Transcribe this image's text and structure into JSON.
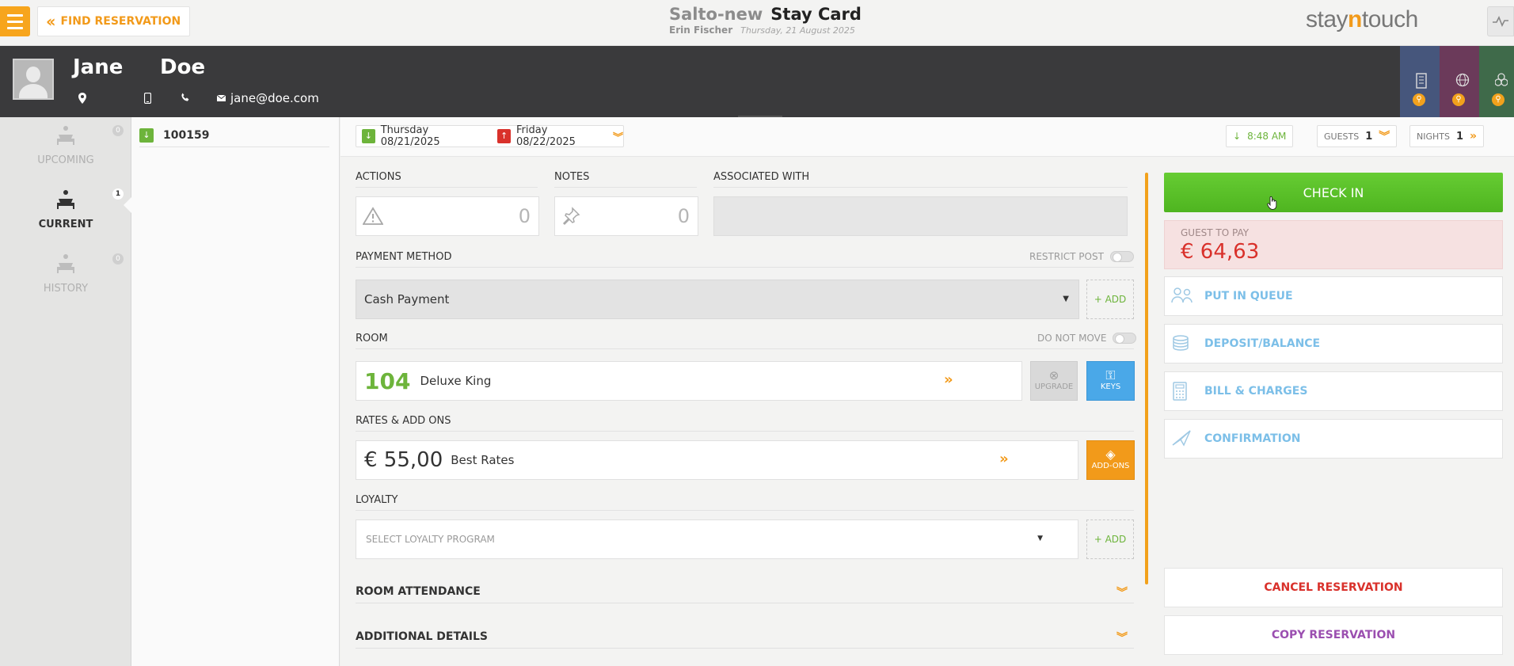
{
  "topbar": {
    "find_reservation_label": "FIND RESERVATION",
    "hotel_name": "Salto-new",
    "page_title": "Stay Card",
    "user_name": "Erin Fischer",
    "business_date": "Thursday, 21 August 2025",
    "logo_pre": "stay",
    "logo_n": "n",
    "logo_post": "touch"
  },
  "guest": {
    "first_name": "Jane",
    "last_name": "Doe",
    "email": "jane@doe.com"
  },
  "nav": {
    "items": [
      {
        "label": "UPCOMING",
        "count": "0"
      },
      {
        "label": "CURRENT",
        "count": "1"
      },
      {
        "label": "HISTORY",
        "count": "0"
      }
    ]
  },
  "reservation_list": {
    "items": [
      {
        "number": "100159"
      }
    ]
  },
  "stay": {
    "arrival": "Thursday 08/21/2025",
    "departure": "Friday 08/22/2025",
    "arrival_time": "8:48 AM",
    "guests_label": "GUESTS",
    "guests_value": "1",
    "nights_label": "NIGHTS",
    "nights_value": "1"
  },
  "sections": {
    "actions_label": "ACTIONS",
    "actions_count": "0",
    "notes_label": "NOTES",
    "notes_count": "0",
    "associated_label": "ASSOCIATED WITH",
    "payment_label": "PAYMENT METHOD",
    "restrict_post_label": "RESTRICT POST",
    "payment_value": "Cash Payment",
    "add_label": "+ ADD",
    "room_label": "ROOM",
    "do_not_move_label": "DO NOT MOVE",
    "room_number": "104",
    "room_type": "Deluxe King",
    "upgrade_label": "UPGRADE",
    "keys_label": "KEYS",
    "rates_label": "RATES & ADD ONS",
    "rate_amount": "€ 55,00",
    "rate_name": "Best Rates",
    "addons_label": "ADD-ONS",
    "loyalty_label": "LOYALTY",
    "loyalty_placeholder": "SELECT LOYALTY PROGRAM",
    "room_attendance_label": "ROOM ATTENDANCE",
    "additional_details_label": "ADDITIONAL DETAILS"
  },
  "right": {
    "check_in_label": "CHECK IN",
    "guest_to_pay_label": "GUEST TO PAY",
    "guest_to_pay_amount": "€ 64,63",
    "put_in_queue_label": "PUT IN QUEUE",
    "deposit_label": "DEPOSIT/BALANCE",
    "bill_label": "BILL & CHARGES",
    "confirmation_label": "CONFIRMATION",
    "cancel_label": "CANCEL RESERVATION",
    "copy_label": "COPY RESERVATION"
  },
  "colors": {
    "accent_orange": "#f29a1a",
    "check_in_green": "#5cc12b",
    "cancel_red": "#d9312b",
    "copy_purple": "#9b4fb0",
    "side_blue": "#7cbfe8",
    "header_dark": "#3a3a3c"
  }
}
